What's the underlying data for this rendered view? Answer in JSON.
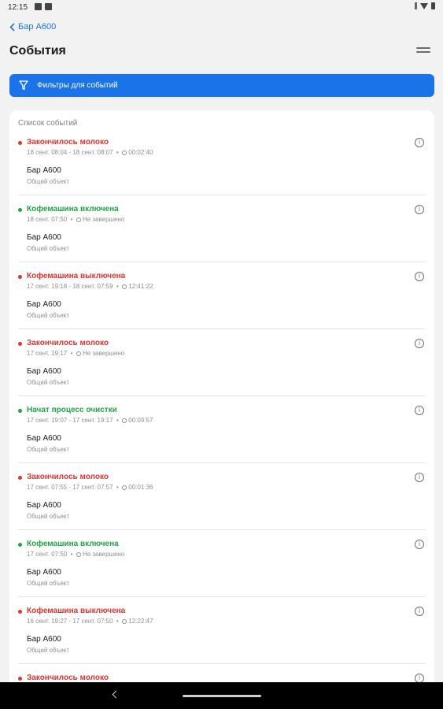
{
  "status_bar": {
    "time": "12:15"
  },
  "header": {
    "back_label": "Бар A600",
    "title": "События"
  },
  "filter_button": {
    "label": "Фильтры для событий"
  },
  "list": {
    "title": "Список событий",
    "events": [
      {
        "name": "Закончилось молоко",
        "status": "red",
        "time": "18 сент. 08:04 - 18 сент. 08:07",
        "duration": "00:02:40",
        "object": "Бар A600",
        "object_type": "Общий объект"
      },
      {
        "name": "Кофемашина включена",
        "status": "green",
        "time": "18 сент. 07:50",
        "duration": "Не завершено",
        "object": "Бар A600",
        "object_type": "Общий объект"
      },
      {
        "name": "Кофемашина выключена",
        "status": "red",
        "time": "17 сент. 19:18 - 18 сент. 07:59",
        "duration": "12:41:22",
        "object": "Бар A600",
        "object_type": "Общий объект"
      },
      {
        "name": "Закончилось молоко",
        "status": "red",
        "time": "17 сент. 19:17",
        "duration": "Не завершено",
        "object": "Бар A600",
        "object_type": "Общий объект"
      },
      {
        "name": "Начат процесс очистки",
        "status": "green",
        "time": "17 сент. 19:07 - 17 сент. 19:17",
        "duration": "00:09:57",
        "object": "Бар A600",
        "object_type": "Общий объект"
      },
      {
        "name": "Закончилось молоко",
        "status": "red",
        "time": "17 сент. 07:55 - 17 сент. 07:57",
        "duration": "00:01:36",
        "object": "Бар A600",
        "object_type": "Общий объект"
      },
      {
        "name": "Кофемашина включена",
        "status": "green",
        "time": "17 сент. 07:50",
        "duration": "Не завершено",
        "object": "Бар A600",
        "object_type": "Общий объект"
      },
      {
        "name": "Кофемашина выключена",
        "status": "red",
        "time": "16 сент. 19:27 - 17 сент. 07:50",
        "duration": "12:22:47",
        "object": "Бар A600",
        "object_type": "Общий объект"
      },
      {
        "name": "Закончилось молоко",
        "status": "red",
        "time": "",
        "duration": "",
        "object": "",
        "object_type": ""
      }
    ]
  },
  "colors": {
    "accent": "#1a73e8",
    "red": "#e8322d",
    "green": "#22a447"
  },
  "icons": {
    "back": "chevron-left-icon",
    "menu": "hamburger-menu-icon",
    "filter": "funnel-filter-icon",
    "info": "info-circle-icon",
    "clock": "clock-icon"
  }
}
